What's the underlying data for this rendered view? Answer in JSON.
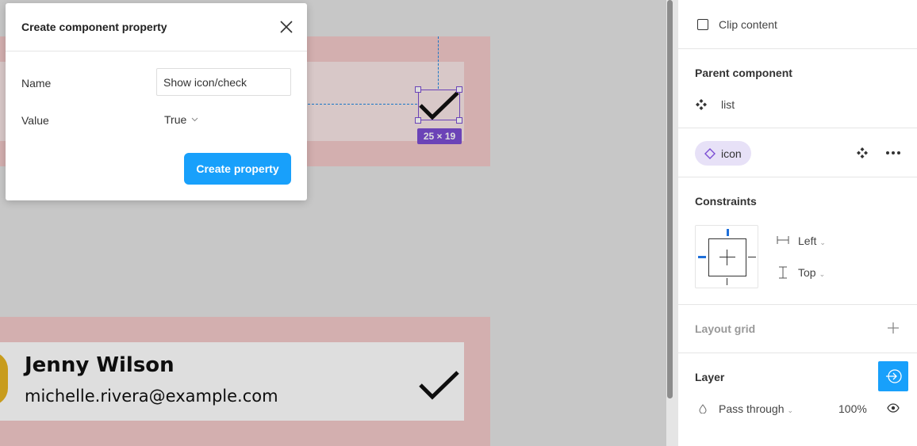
{
  "dialog": {
    "title": "Create component property",
    "name_label": "Name",
    "name_value": "Show icon/check",
    "value_label": "Value",
    "value_selected": "True",
    "create_button": "Create property"
  },
  "canvas": {
    "person_name": "Jenny Wilson",
    "person_email": "michelle.rivera@example.com",
    "size_badge": "25 × 19"
  },
  "panel": {
    "clip_content": "Clip content",
    "parent_component_title": "Parent component",
    "parent_component_name": "list",
    "instance_pill": "icon",
    "constraints_title": "Constraints",
    "constraint_horizontal": "Left",
    "constraint_vertical": "Top",
    "layout_grid_title": "Layout grid",
    "layer_title": "Layer",
    "blend_mode": "Pass through",
    "opacity": "100%"
  },
  "colors": {
    "accent_blue": "#18a0fb",
    "selection_purple": "#7b4dd3",
    "frame_pink": "#f3c9c9",
    "pill_bg": "#e7e1f7"
  }
}
